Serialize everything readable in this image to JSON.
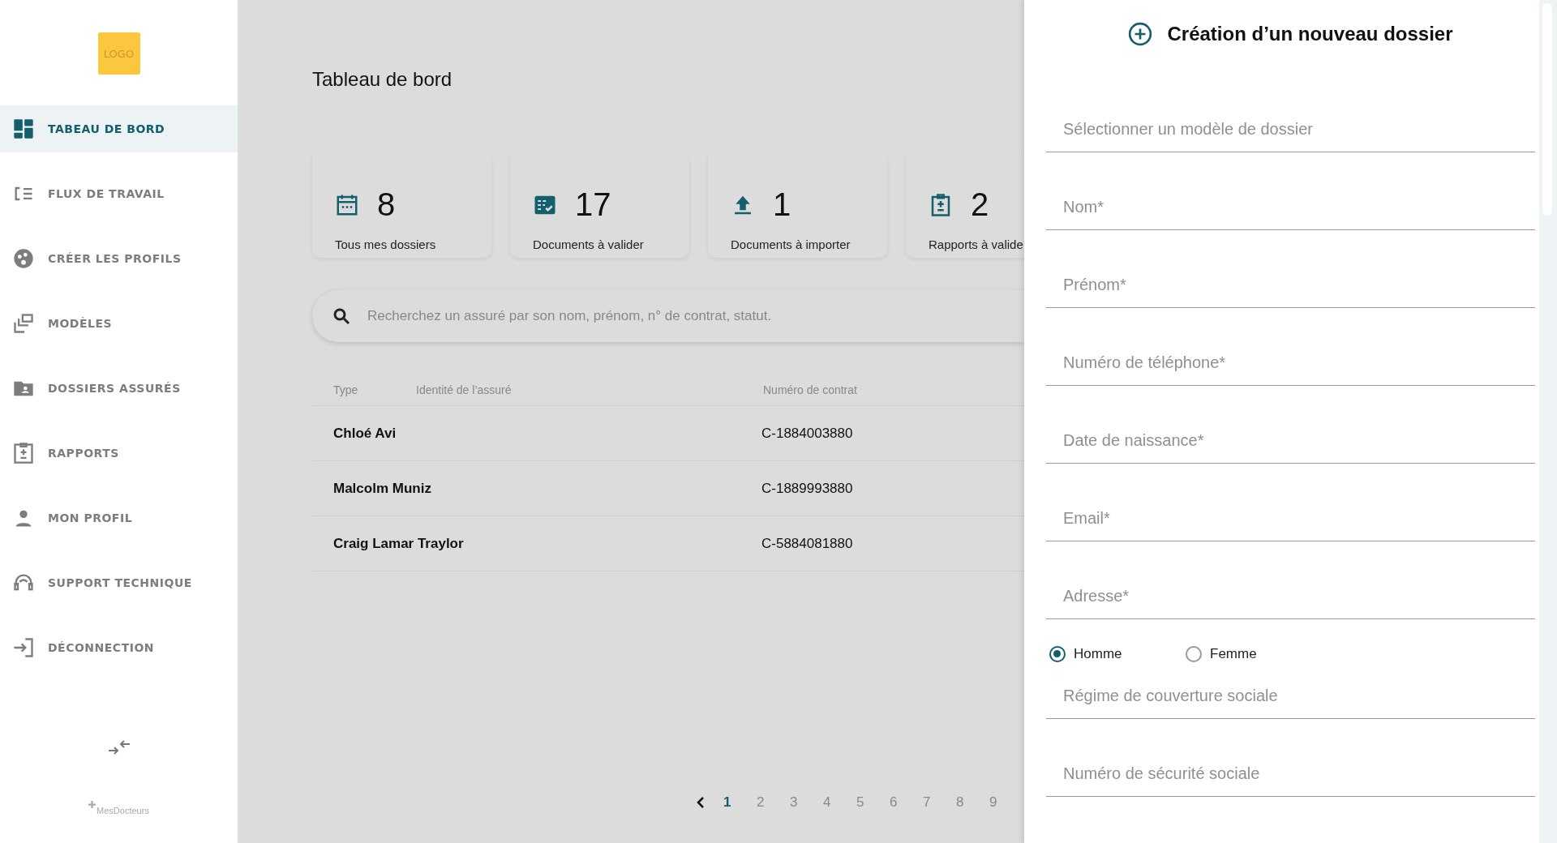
{
  "sidebar": {
    "logo": "LOGO",
    "items": [
      {
        "label": "TABEAU DE BORD",
        "selected": true
      },
      {
        "label": "FLUX DE TRAVAIL",
        "selected": false
      },
      {
        "label": "CRÉER LES PROFILS",
        "selected": false
      },
      {
        "label": "MODÈLES",
        "selected": false
      },
      {
        "label": "DOSSIERS ASSURÉS",
        "selected": false
      },
      {
        "label": "RAPPORTS",
        "selected": false
      },
      {
        "label": "MON PROFIL",
        "selected": false
      },
      {
        "label": "SUPPORT TECHNIQUE",
        "selected": false
      },
      {
        "label": "DÉCONNECTION",
        "selected": false
      }
    ],
    "footer": "MesDocteurs"
  },
  "main": {
    "title": "Tableau de bord",
    "cards": [
      {
        "count": "8",
        "label": "Tous mes dossiers"
      },
      {
        "count": "17",
        "label": "Documents à valider"
      },
      {
        "count": "1",
        "label": "Documents à importer"
      },
      {
        "count": "2",
        "label": "Rapports à valide"
      }
    ],
    "search": {
      "placeholder": "Recherchez un assuré par son nom, prénom, n° de contrat, statut."
    },
    "table": {
      "columns": [
        "Type",
        "Identité de l’assuré",
        "Numéro de contrat"
      ],
      "rows": [
        {
          "name": "Chloé Avi",
          "contract": "C-1884003880"
        },
        {
          "name": "Malcolm Muniz",
          "contract": "C-1889993880"
        },
        {
          "name": "Craig Lamar Traylor",
          "contract": "C-5884081880"
        }
      ]
    },
    "pagination": {
      "pages": [
        {
          "label": "1",
          "selected": true
        },
        {
          "label": "2",
          "selected": false
        },
        {
          "label": "3",
          "selected": false
        },
        {
          "label": "4",
          "selected": false
        },
        {
          "label": "5",
          "selected": false
        },
        {
          "label": "6",
          "selected": false
        },
        {
          "label": "7",
          "selected": false
        },
        {
          "label": "8",
          "selected": false
        },
        {
          "label": "9",
          "selected": false
        }
      ]
    }
  },
  "panel": {
    "title": "Création d’un nouveau dossier",
    "fields_top": [
      {
        "placeholder": "Sélectionner un modèle de dossier"
      },
      {
        "placeholder": "Nom*"
      },
      {
        "placeholder": "Prénom*"
      },
      {
        "placeholder": "Numéro de téléphone*"
      },
      {
        "placeholder": "Date de naissance*"
      },
      {
        "placeholder": "Email*"
      },
      {
        "placeholder": "Adresse*"
      }
    ],
    "gender": [
      {
        "label": "Homme",
        "selected": true
      },
      {
        "label": "Femme",
        "selected": false
      }
    ],
    "fields_bottom": [
      {
        "placeholder": "Régime de couverture sociale"
      },
      {
        "placeholder": "Numéro de sécurité sociale"
      }
    ]
  }
}
